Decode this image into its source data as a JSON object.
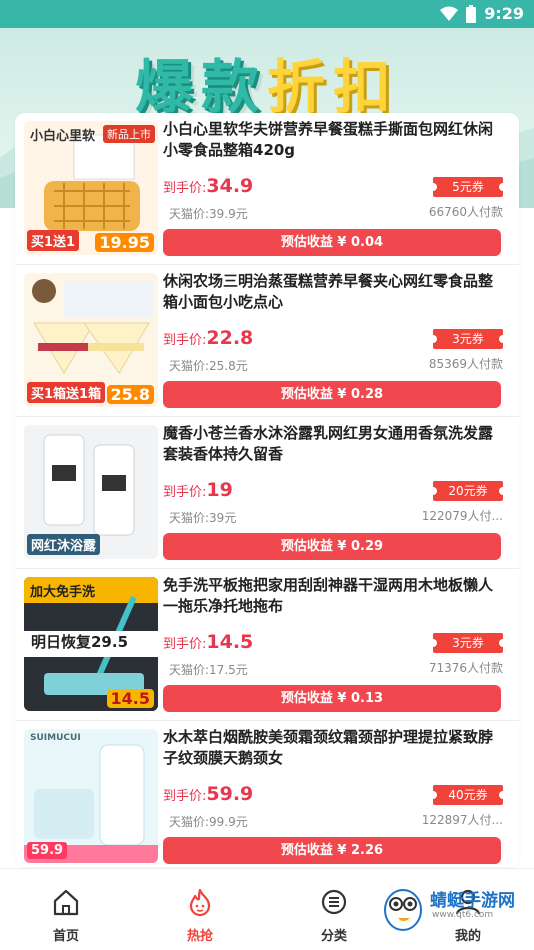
{
  "status": {
    "time": "9:29"
  },
  "banner": {
    "title_part1": "爆款",
    "title_part2": "折扣"
  },
  "labels": {
    "price_prefix": "到手价:",
    "tmall_prefix": "天猫价:",
    "earn_prefix": "预估收益 ¥ "
  },
  "items": [
    {
      "title": "小白心里软华夫饼营养早餐蛋糕手撕面包网红休闲小零食品整箱420g",
      "price": "34.9",
      "tmall": "39.9元",
      "coupon": "5元券",
      "sold": "66760人付款",
      "earn": "0.04",
      "thumb": {
        "brand": "小白心里软",
        "badge": "新品上市",
        "label": "买1送1",
        "price": "19.95"
      }
    },
    {
      "title": "休闲农场三明治蒸蛋糕营养早餐夹心网红零食品整箱小面包小吃点心",
      "price": "22.8",
      "tmall": "25.8元",
      "coupon": "3元券",
      "sold": "85369人付款",
      "earn": "0.28",
      "thumb": {
        "brand": "",
        "badge": "",
        "label": "买1箱送1箱",
        "price": "25.8"
      }
    },
    {
      "title": "魔香小苍兰香水沐浴露乳网红男女通用香氛洗发露套装香体持久留香",
      "price": "19",
      "tmall": "39元",
      "coupon": "20元券",
      "sold": "122079人付...",
      "earn": "0.29",
      "thumb": {
        "brand": "",
        "badge": "",
        "label": "网红沐浴露",
        "price": ""
      }
    },
    {
      "title": "免手洗平板拖把家用刮刮神器干湿两用木地板懒人一拖乐净托地拖布",
      "price": "14.5",
      "tmall": "17.5元",
      "coupon": "3元券",
      "sold": "71376人付款",
      "earn": "0.13",
      "thumb": {
        "brand": "加大免手洗",
        "badge": "",
        "label": "明日恢复29.5",
        "price": "14.5"
      }
    },
    {
      "title": "水木萃白烟酰胺美颈霜颈纹霜颈部护理提拉紧致脖子纹颈膜天鹅颈女",
      "price": "59.9",
      "tmall": "99.9元",
      "coupon": "40元券",
      "sold": "122897人付...",
      "earn": "2.26",
      "thumb": {
        "brand": "SUIMUCUI",
        "badge": "",
        "label": "59.9",
        "price": ""
      }
    }
  ],
  "nav": [
    {
      "label": "首页",
      "icon": "home-icon"
    },
    {
      "label": "热抢",
      "icon": "flame-icon"
    },
    {
      "label": "分类",
      "icon": "category-icon"
    },
    {
      "label": "我的",
      "icon": "user-icon"
    }
  ],
  "watermark": {
    "text": "蜻蜓手游网",
    "url": "www.qt6.com"
  },
  "colors": {
    "accent": "#f2433b",
    "teal": "#38b6a7",
    "button": "#f0484e"
  }
}
